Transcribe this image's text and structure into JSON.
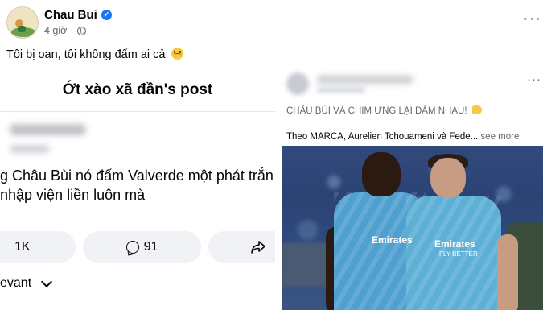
{
  "post": {
    "author": "Chau Bui",
    "time": "4 giờ",
    "dot": "·",
    "caption": "Tôi bị oan, tôi không đấm ai cả",
    "more": "···"
  },
  "left_panel": {
    "title": "Ớt xào xã đần's post",
    "body_line1": "g Châu Bùi nó đấm Valverde một phát trắn",
    "body_line2": "nhập viện liền luôn mà",
    "likes": "1K",
    "comments": "91",
    "sort_label": "evant"
  },
  "right_panel": {
    "more": "···",
    "headline": "CHÂU BÙI VÀ CHIM ƯNG LẠI ĐÁM NHAU!",
    "text": "Theo MARCA, Aurelien Tchouameni và Fede...",
    "see_more": "see more",
    "sponsor": "Emirates",
    "sponsor_sub": "FLY BETTER"
  }
}
